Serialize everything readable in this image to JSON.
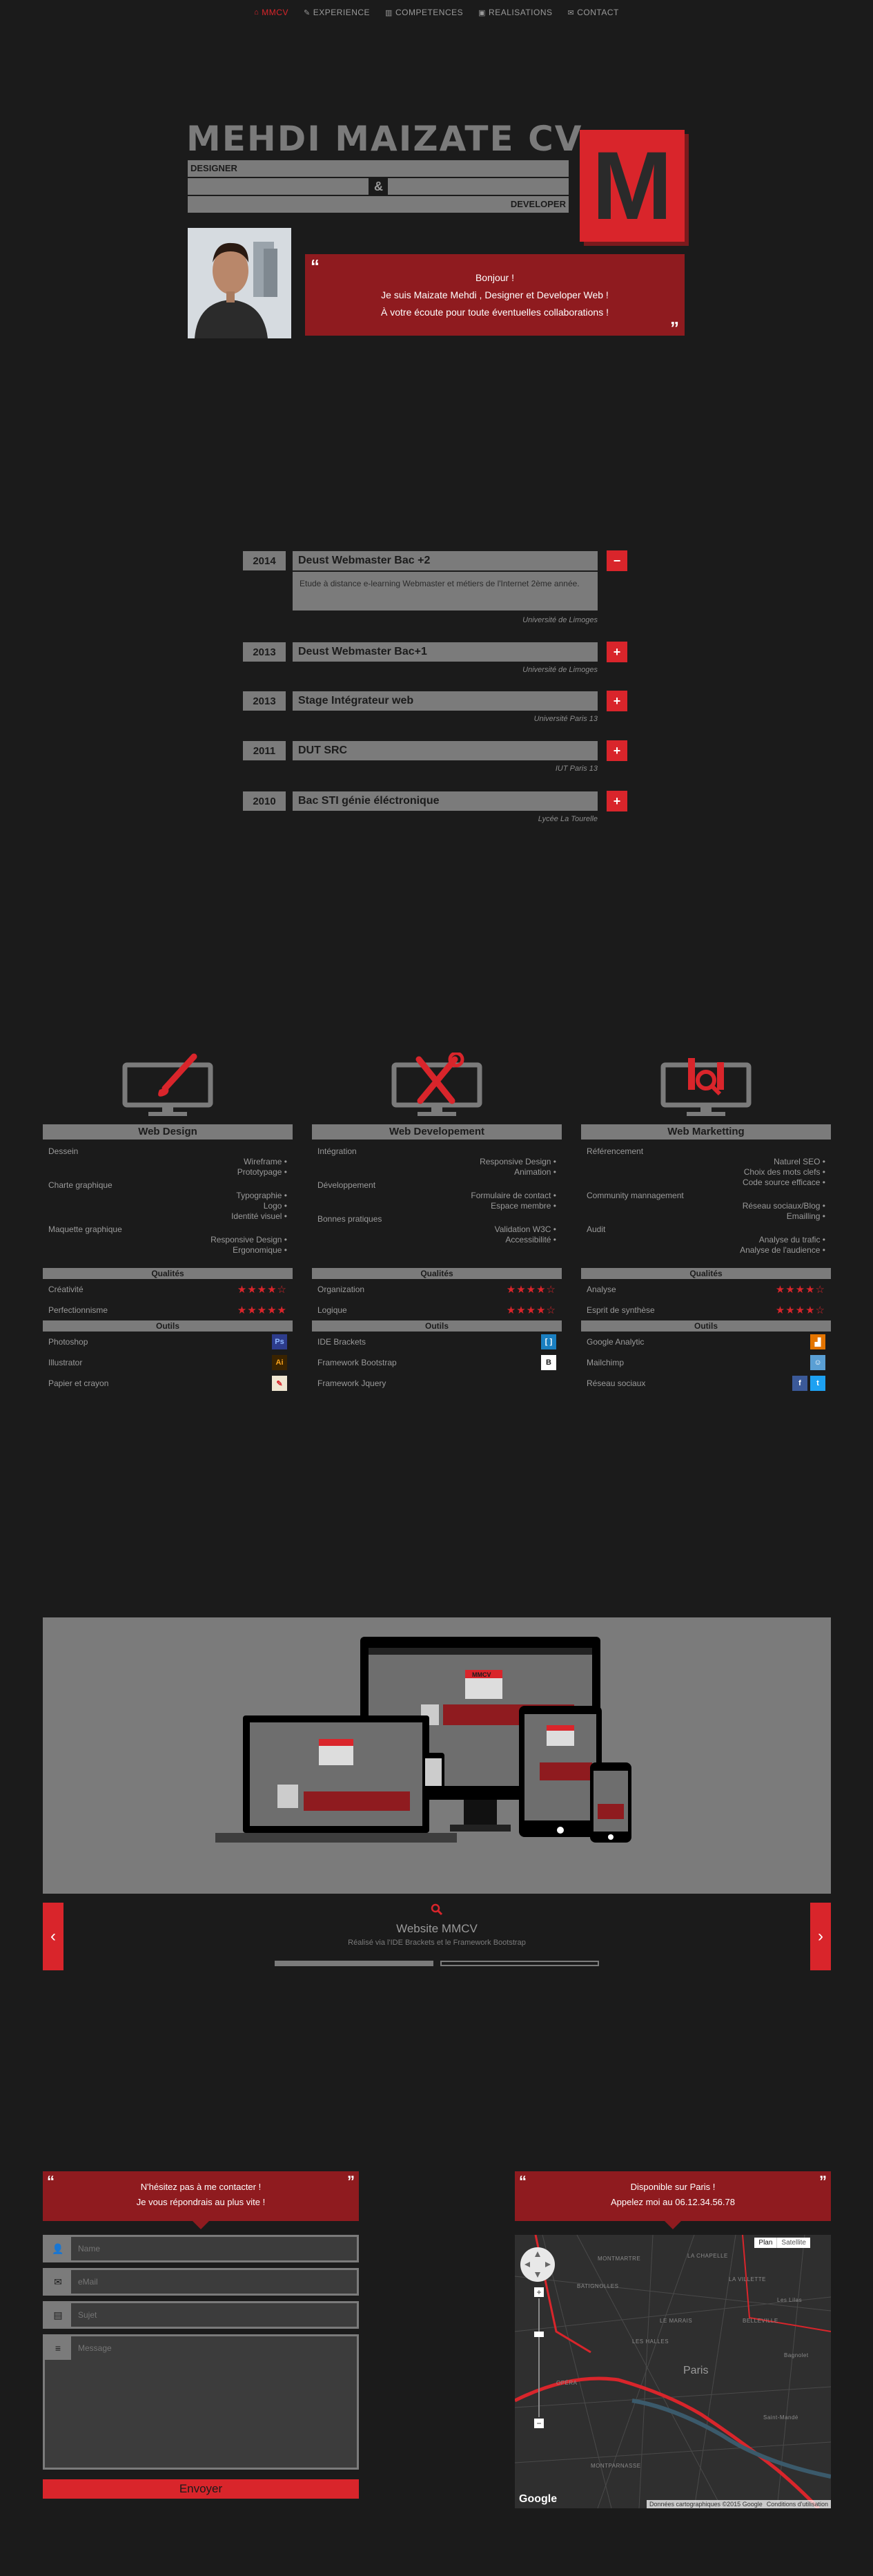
{
  "nav": {
    "items": [
      {
        "label": "MMCV",
        "icon": "home-icon",
        "active": true
      },
      {
        "label": "EXPERIENCE",
        "icon": "graduation-icon",
        "active": false
      },
      {
        "label": "COMPETENCES",
        "icon": "chart-icon",
        "active": false
      },
      {
        "label": "REALISATIONS",
        "icon": "image-icon",
        "active": false
      },
      {
        "label": "CONTACT",
        "icon": "chat-icon",
        "active": false
      }
    ]
  },
  "header": {
    "title": "MEHDI MAIZATE CV",
    "designer": "DESIGNER",
    "ampersand": "&",
    "developer": "DEVELOPER",
    "logo_letter": "M",
    "quote_lines": [
      "Bonjour !",
      "Je suis Maizate Mehdi , Designer et Developer Web !",
      "À votre écoute pour toute éventuelles collaborations !"
    ],
    "quote_open": "“",
    "quote_close": "”"
  },
  "timeline": [
    {
      "year": "2014",
      "title": "Deust Webmaster Bac +2",
      "detail": "Etude à distance e-learning Webmaster et métiers de l'Internet 2ème année.",
      "school": "Université de Limoges",
      "toggle": "−",
      "expanded": true
    },
    {
      "year": "2013",
      "title": "Deust Webmaster Bac+1",
      "detail": "",
      "school": "Université de Limoges",
      "toggle": "+",
      "expanded": false
    },
    {
      "year": "2013",
      "title": "Stage Intégrateur web",
      "detail": "",
      "school": "Université Paris 13",
      "toggle": "+",
      "expanded": false
    },
    {
      "year": "2011",
      "title": "DUT SRC",
      "detail": "",
      "school": "IUT Paris 13",
      "toggle": "+",
      "expanded": false
    },
    {
      "year": "2010",
      "title": "Bac STI génie éléctronique",
      "detail": "",
      "school": "Lycée La Tourelle",
      "toggle": "+",
      "expanded": false
    }
  ],
  "skills": [
    {
      "title": "Web Design",
      "icon": "paintbrush-monitor-icon",
      "groups": [
        {
          "name": "Dessein",
          "items": [
            "Wireframe",
            "Prototypage"
          ]
        },
        {
          "name": "Charte graphique",
          "items": [
            "Typographie",
            "Logo",
            "Identité visuel"
          ]
        },
        {
          "name": "Maquette graphique",
          "items": [
            "Responsive Design",
            "Ergonomique"
          ]
        }
      ],
      "qualities_label": "Qualités",
      "qualities": [
        {
          "name": "Créativité",
          "rating": 4
        },
        {
          "name": "Perfectionnisme",
          "rating": 5
        }
      ],
      "tools_label": "Outils",
      "tools": [
        {
          "name": "Photoshop",
          "icon": "photoshop-icon",
          "glyph": "Ps",
          "color": "#2d3c8c",
          "fg": "#8fb7ff"
        },
        {
          "name": "Illustrator",
          "icon": "illustrator-icon",
          "glyph": "Ai",
          "color": "#3a2300",
          "fg": "#f7a21b"
        },
        {
          "name": "Papier et crayon",
          "icon": "pencil-icon",
          "glyph": "✎",
          "color": "#f0e6d2",
          "fg": "#d9252b"
        }
      ]
    },
    {
      "title": "Web Developement",
      "icon": "tools-monitor-icon",
      "groups": [
        {
          "name": "Intégration",
          "items": [
            "Responsive Design",
            "Animation"
          ]
        },
        {
          "name": "Développement",
          "items": [
            "Formulaire de contact",
            "Espace membre"
          ]
        },
        {
          "name": "Bonnes pratiques",
          "items": [
            "Validation W3C",
            "Accessibilité"
          ]
        }
      ],
      "qualities_label": "Qualités",
      "qualities": [
        {
          "name": "Organization",
          "rating": 4
        },
        {
          "name": "Logique",
          "rating": 4
        }
      ],
      "tools_label": "Outils",
      "tools": [
        {
          "name": "IDE Brackets",
          "icon": "brackets-icon",
          "glyph": "[ ]",
          "color": "#1a7fc1",
          "fg": "#ffffff"
        },
        {
          "name": "Framework Bootstrap",
          "icon": "bootstrap-icon",
          "glyph": "B",
          "color": "#ffffff",
          "fg": "#1b1b1b"
        },
        {
          "name": "Framework Jquery",
          "icon": "jquery-icon",
          "glyph": "",
          "color": "#1b1b1b",
          "fg": "#1b1b1b"
        }
      ]
    },
    {
      "title": "Web Marketting",
      "icon": "analytics-monitor-icon",
      "groups": [
        {
          "name": "Référencement",
          "items": [
            "Naturel SEO",
            "Choix des mots clefs",
            "Code source efficace"
          ]
        },
        {
          "name": "Community mannagement",
          "items": [
            "Réseau sociaux/Blog",
            "Emailling"
          ]
        },
        {
          "name": "Audit",
          "items": [
            "Analyse du trafic",
            "Analyse de l'audience"
          ]
        }
      ],
      "qualities_label": "Qualités",
      "qualities": [
        {
          "name": "Analyse",
          "rating": 4
        },
        {
          "name": "Esprit de synthèse",
          "rating": 4
        }
      ],
      "tools_label": "Outils",
      "tools": [
        {
          "name": "Google Analytic",
          "icon": "analytics-icon",
          "glyph": "▟",
          "color": "#e37400",
          "fg": "#ffffff"
        },
        {
          "name": "Mailchimp",
          "icon": "mailchimp-icon",
          "glyph": "☺",
          "color": "#5a9fd4",
          "fg": "#ffffff"
        },
        {
          "name": "Réseau sociaux",
          "icon": "social-icon",
          "glyph": "f",
          "color": "#3b5998",
          "fg": "#ffffff"
        }
      ]
    }
  ],
  "portfolio": {
    "icon": "search-icon",
    "title": "Website MMCV",
    "subtitle": "Réalisé via l'IDE Brackets et le Framework Bootstrap",
    "prev": "‹",
    "next": "›",
    "slides": 2,
    "active_slide": 0,
    "mock_logo": "MMCV",
    "mock_name": "MAIZATE MEHDI"
  },
  "contact": {
    "left_lines": [
      "N'hésitez pas à me contacter !",
      "Je vous répondrais au plus vite !"
    ],
    "right_lines": [
      "Disponible sur Paris !",
      "Appelez moi au 06.12.34.56.78"
    ],
    "fields": [
      {
        "placeholder": "Name",
        "icon": "user-icon"
      },
      {
        "placeholder": "eMail",
        "icon": "mail-icon"
      },
      {
        "placeholder": "Sujet",
        "icon": "file-icon"
      }
    ],
    "message_placeholder": "Message",
    "message_icon": "list-icon",
    "submit": "Envoyer"
  },
  "map": {
    "btn_plan": "Plan",
    "btn_satellite": "Satellite",
    "attribution": "Données cartographiques ©2015 Google",
    "terms": "Conditions d'utilisation",
    "google": "Google",
    "city": "Paris",
    "labels": [
      "MONTMARTRE",
      "LA CHAPELLE",
      "BATIGNOLLES",
      "LES HALLES",
      "BELLEVILLE",
      "LA VILLETTE",
      "Les Lilas",
      "Bagnolet",
      "Saint-Mandé",
      "OPÉRA",
      "LE MARAIS",
      "MONTPARNASSE"
    ]
  },
  "colors": {
    "accent": "#d9252b",
    "dark_red": "#8f1b1f",
    "gray": "#7b7b7b",
    "bg": "#1b1b1b"
  }
}
